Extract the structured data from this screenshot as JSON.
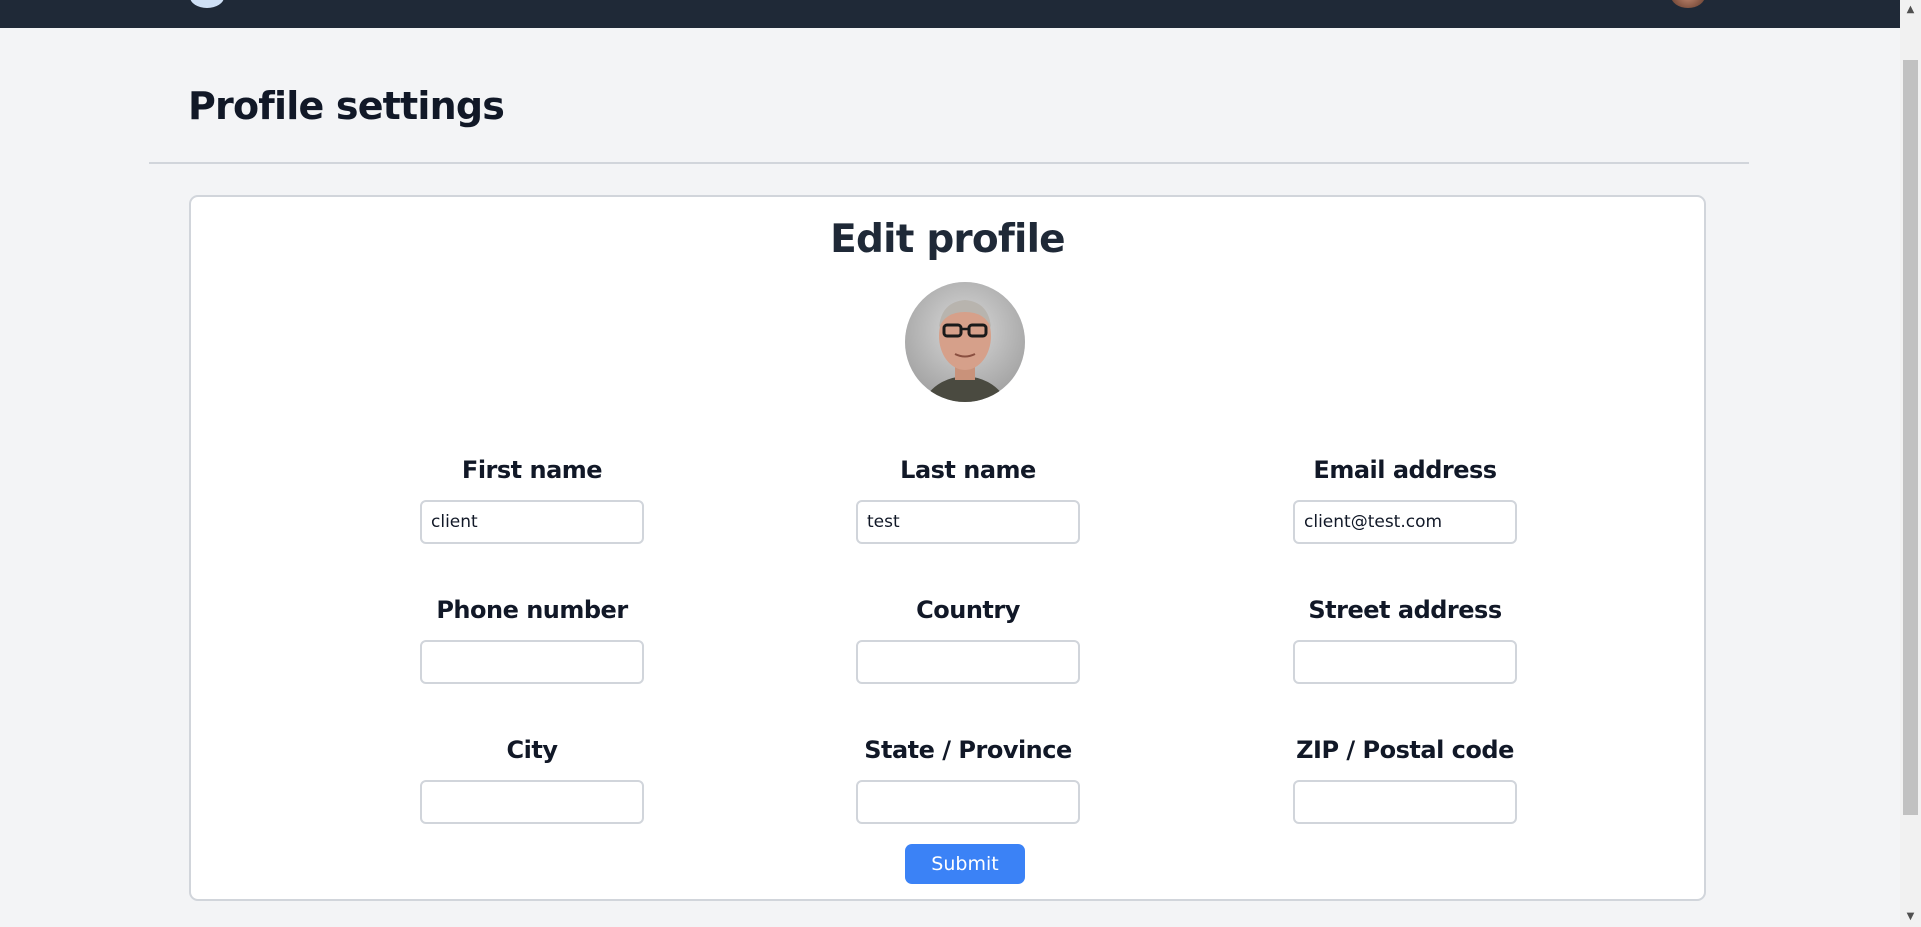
{
  "page": {
    "title": "Profile settings"
  },
  "card": {
    "title": "Edit profile"
  },
  "fields": [
    {
      "label": "First name",
      "value": "client"
    },
    {
      "label": "Last name",
      "value": "test"
    },
    {
      "label": "Email address",
      "value": "client@test.com"
    },
    {
      "label": "Phone number",
      "value": ""
    },
    {
      "label": "Country",
      "value": ""
    },
    {
      "label": "Street address",
      "value": ""
    },
    {
      "label": "City",
      "value": ""
    },
    {
      "label": "State / Province",
      "value": ""
    },
    {
      "label": "ZIP / Postal code",
      "value": ""
    }
  ],
  "submit": {
    "label": "Submit"
  },
  "colors": {
    "topbar": "#1f2937",
    "accent": "#3b82f6",
    "background": "#f3f4f6"
  },
  "icons": {
    "scroll_up": "scroll-up-arrow-icon",
    "scroll_down": "scroll-down-arrow-icon"
  }
}
